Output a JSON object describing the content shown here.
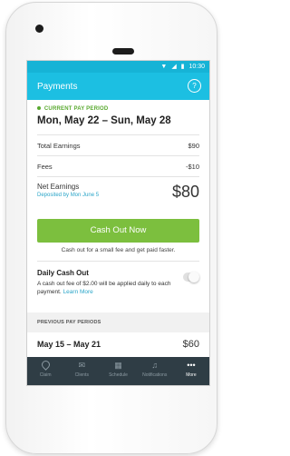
{
  "status_bar": {
    "time": "10:30"
  },
  "app_bar": {
    "title": "Payments",
    "help_icon": "?"
  },
  "current_period": {
    "label": "CURRENT PAY PERIOD",
    "range": "Mon, May 22 – Sun, May 28",
    "total_earnings_label": "Total Earnings",
    "total_earnings_value": "$90",
    "fees_label": "Fees",
    "fees_value": "-$10",
    "net_label": "Net Earnings",
    "net_sub": "Deposited by Mon June 5",
    "net_value": "$80"
  },
  "cash_out": {
    "button_label": "Cash Out Now",
    "note": "Cash out for a small fee and get paid faster."
  },
  "daily_cash_out": {
    "title": "Daily Cash Out",
    "description": "A cash out fee of $2.00 will be applied daily to each payment.",
    "learn_more": "Learn More",
    "enabled": false
  },
  "previous_periods": {
    "header": "PREVIOUS PAY PERIODS",
    "items": [
      {
        "range": "May 15 – May 21",
        "amount": "$60"
      }
    ]
  },
  "tabs": [
    {
      "label": "Claim",
      "icon": "map-pin-icon",
      "active": false
    },
    {
      "label": "Clients",
      "icon": "mail-icon",
      "active": false
    },
    {
      "label": "Schedule",
      "icon": "calendar-icon",
      "active": false
    },
    {
      "label": "Notifications",
      "icon": "bell-icon",
      "active": false
    },
    {
      "label": "More",
      "icon": "more-icon",
      "active": true
    }
  ],
  "colors": {
    "accent": "#1cbfe2",
    "cash_button": "#7cbf3e",
    "tab_bar": "#2f3d45",
    "period_label": "#59a92f"
  }
}
